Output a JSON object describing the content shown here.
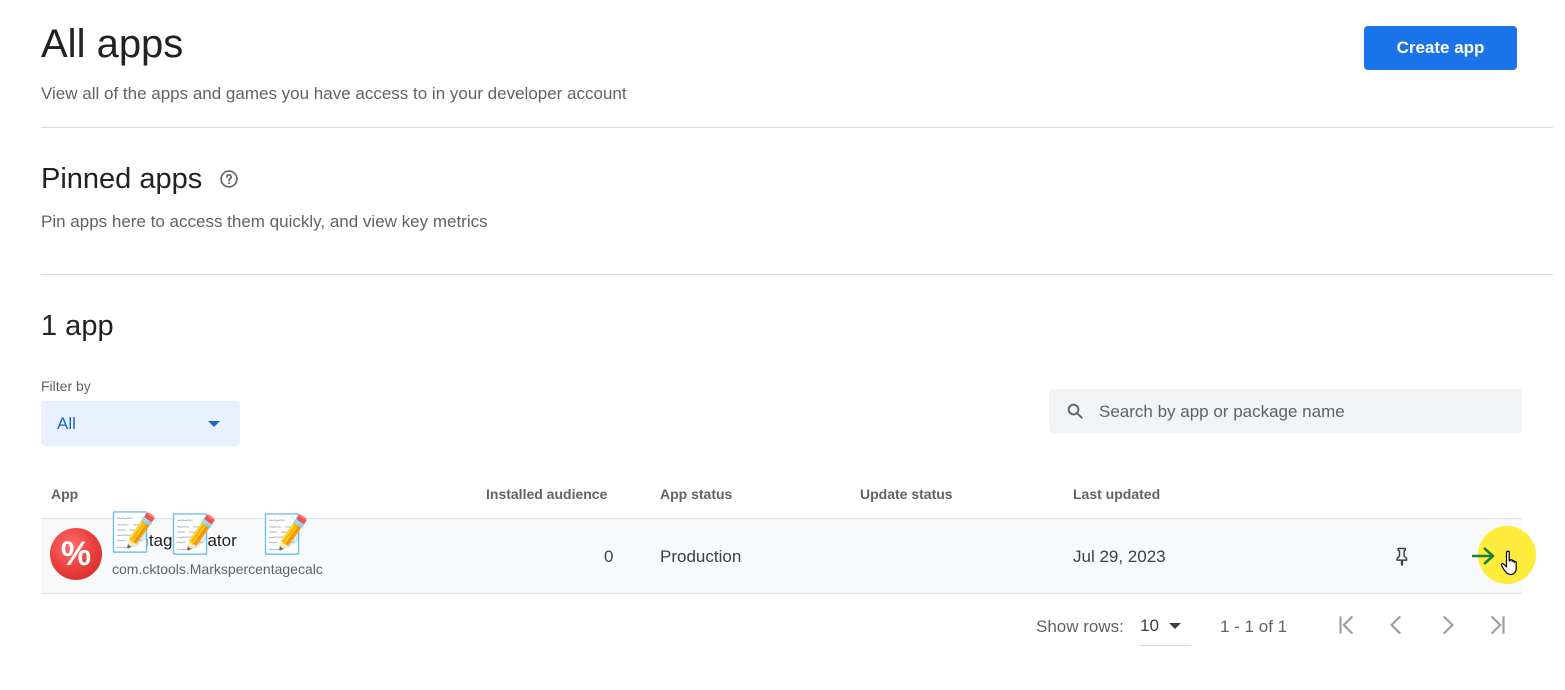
{
  "header": {
    "title": "All apps",
    "subtitle": "View all of the apps and games you have access to in your developer account",
    "create_label": "Create app"
  },
  "pinned": {
    "title": "Pinned apps",
    "description": "Pin apps here to access them quickly, and view key metrics",
    "help_icon": "help-circle-icon"
  },
  "apps_section": {
    "title": "1 app",
    "filter_label": "Filter by",
    "filter_value": "All",
    "search_placeholder": "Search by app or package name"
  },
  "table": {
    "columns": [
      "App",
      "Installed audience",
      "App status",
      "Update status",
      "Last updated"
    ],
    "rows": [
      {
        "name": "Marks percentage Calculator",
        "name_visible": "s p ntage C lator",
        "package": "com.cktools.Markspercentagecalc",
        "icon_glyph": "%",
        "installed_audience": "0",
        "app_status": "Production",
        "update_status": "",
        "last_updated": "Jul 29, 2023"
      }
    ]
  },
  "pagination": {
    "show_rows_label": "Show rows:",
    "rows_value": "10",
    "range": "1 - 1 of 1"
  },
  "overlay": {
    "memo_glyph": "📝",
    "highlight_color": "#ffeb3b"
  },
  "colors": {
    "primary": "#1a73e8",
    "filter_bg": "#e8f0fe",
    "arrow": "#188038"
  }
}
